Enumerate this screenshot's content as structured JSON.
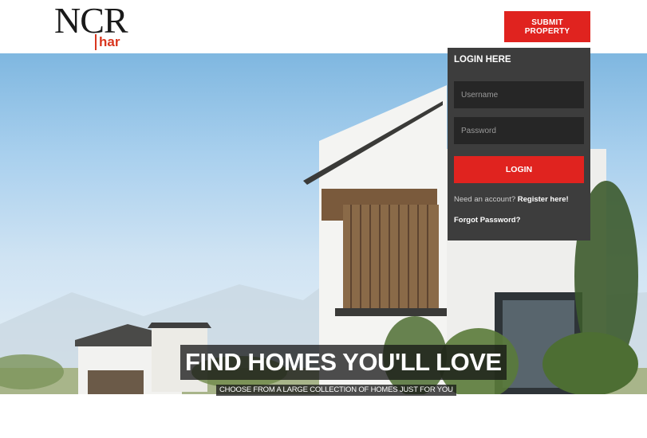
{
  "logo": {
    "main": "NCR",
    "sub": "har"
  },
  "header": {
    "submit_label": "SUBMIT PROPERTY"
  },
  "hero": {
    "title": "FIND HOMES YOU'LL LOVE",
    "subtitle": "CHOOSE FROM A LARGE COLLECTION OF HOMES JUST FOR YOU"
  },
  "login": {
    "title": "LOGIN HERE",
    "username_placeholder": "Username",
    "password_placeholder": "Password",
    "button_label": "LOGIN",
    "register_prompt": "Need an account?",
    "register_link": "Register here!",
    "forgot_link": "Forgot Password?"
  },
  "colors": {
    "accent": "#e0231f",
    "panel": "#3d3d3d",
    "input": "#262626"
  }
}
